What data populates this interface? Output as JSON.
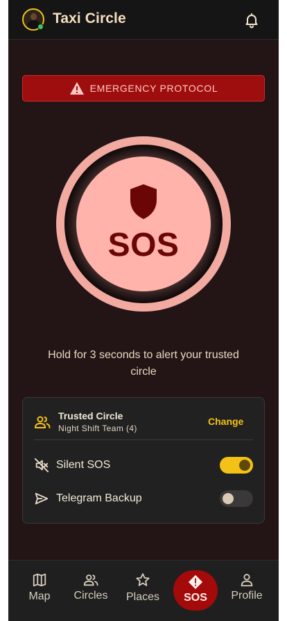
{
  "app": {
    "title": "Taxi Circle",
    "avatar_icon": "user-avatar-icon",
    "notifications_icon": "bell-icon"
  },
  "banner": {
    "label": "EMERGENCY PROTOCOL",
    "icon": "warning-triangle-icon",
    "color": "#9f0e0e"
  },
  "sos_button": {
    "label": "SOS",
    "icon": "shield-icon",
    "color": "#ffb3ab"
  },
  "hint": {
    "text": "Hold for 3 seconds to alert your trusted circle"
  },
  "trusted_circle": {
    "title": "Trusted Circle",
    "subtitle": "Night Shift Team (4)",
    "action_label": "Change",
    "icon": "group-icon",
    "settings": [
      {
        "label": "Silent SOS",
        "icon": "volume-off-icon",
        "enabled": true
      },
      {
        "label": "Telegram Backup",
        "icon": "send-icon",
        "enabled": false
      }
    ]
  },
  "nav": {
    "items": [
      {
        "label": "Map",
        "icon": "map-icon"
      },
      {
        "label": "Circles",
        "icon": "circles-icon"
      },
      {
        "label": "Places",
        "icon": "star-icon"
      },
      {
        "label": "SOS",
        "icon": "sos-alert-icon",
        "active": true
      },
      {
        "label": "Profile",
        "icon": "profile-icon"
      }
    ]
  },
  "colors": {
    "accent": "#f4c216",
    "danger": "#a40a0a",
    "background": "#231516"
  }
}
